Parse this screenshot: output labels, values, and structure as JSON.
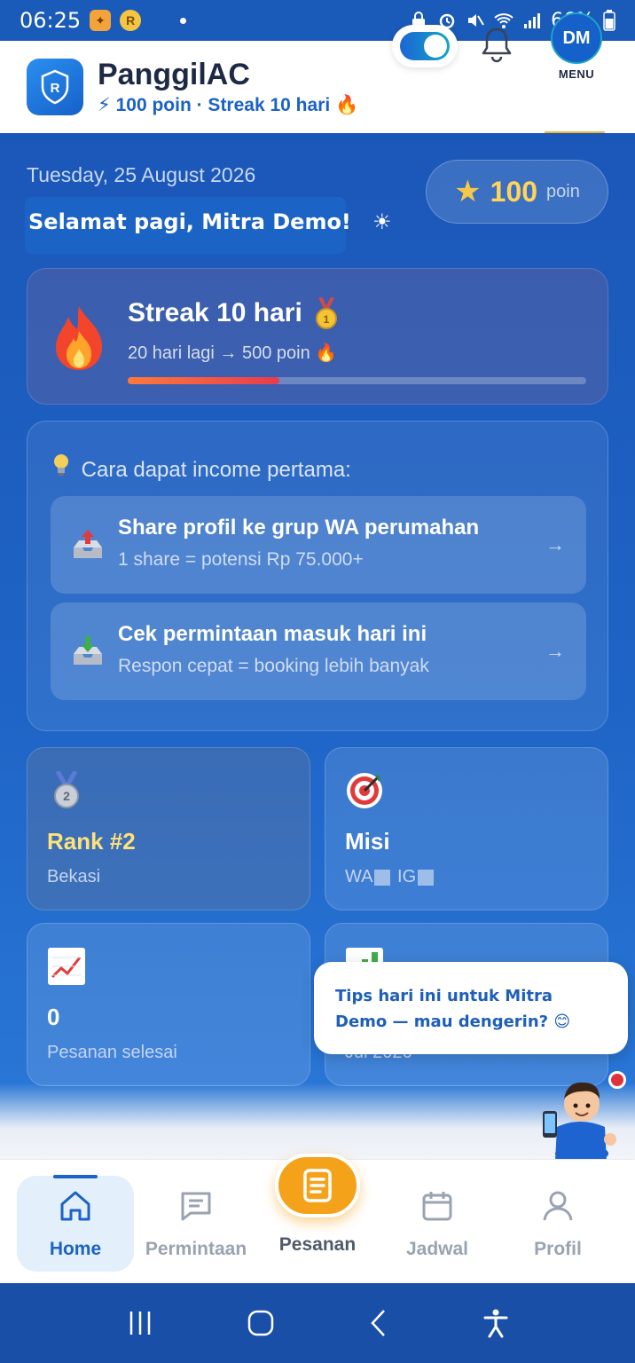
{
  "status_bar": {
    "time": "06:25",
    "battery": "66%"
  },
  "header": {
    "app_name": "PanggilAC",
    "subtitle": "⚡ 100 poin · Streak 10 hari 🔥",
    "avatar_initials": "DM",
    "menu_label": "MENU"
  },
  "hero": {
    "date": "Tuesday, 25 August 2026",
    "greeting": "Selamat pagi, Mitra Demo!",
    "greeting_suffix": "☀",
    "points_value": "100",
    "points_unit": "poin"
  },
  "streak": {
    "title": "Streak 10 hari",
    "subtitle": "20 hari lagi → 500 poin 🔥",
    "progress": 0.33
  },
  "income": {
    "title": "Cara dapat income pertama:",
    "items": [
      {
        "title": "Share profil ke grup WA perumahan",
        "subtitle": "1 share = potensi Rp 75.000+",
        "arrow": "→"
      },
      {
        "title": "Cek permintaan masuk hari ini",
        "subtitle": "Respon cepat = booking lebih banyak",
        "arrow": "→"
      }
    ]
  },
  "stats": {
    "rank": {
      "title": "Rank #2",
      "subtitle": "Bekasi"
    },
    "mission": {
      "title": "Misi",
      "subtitle_wa": "WA",
      "subtitle_ig": "IG"
    },
    "orders": {
      "title": "0",
      "subtitle": "Pesanan selesai"
    },
    "fourth": {
      "subtitle": "Jul 2026"
    }
  },
  "assistant": {
    "bubble_text": "Tips hari ini untuk Mitra Demo — mau dengerin? 😊"
  },
  "bottom_nav": {
    "items": [
      {
        "label": "Home"
      },
      {
        "label": "Permintaan"
      },
      {
        "label": "Pesanan"
      },
      {
        "label": "Jadwal"
      },
      {
        "label": "Profil"
      }
    ]
  },
  "colors": {
    "primary": "#1b63c4",
    "accent": "#f5a21b",
    "gold": "#ffd45a"
  }
}
